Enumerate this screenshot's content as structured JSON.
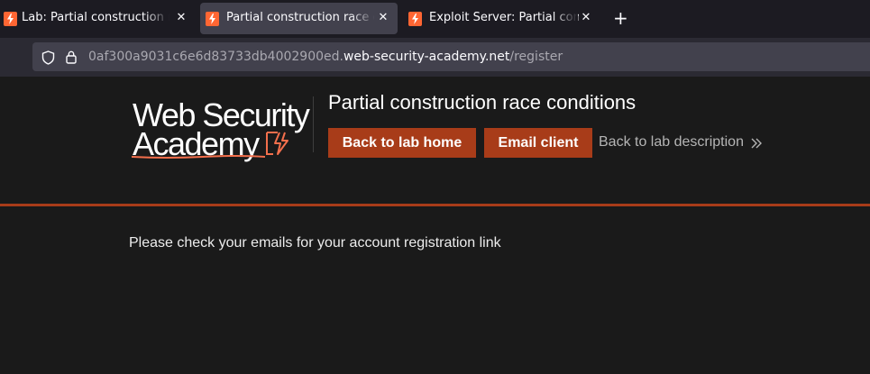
{
  "browser": {
    "tabs": [
      {
        "title": "Lab: Partial construction race conditions",
        "active": false,
        "icon": "bolt-icon"
      },
      {
        "title": "Partial construction race conditions",
        "active": true,
        "icon": "bolt-icon"
      },
      {
        "title": "Exploit Server: Partial construction race conditions",
        "active": false,
        "icon": "bolt-icon"
      }
    ],
    "close_glyph": "✕",
    "new_tab_glyph": "+",
    "url": {
      "prefix": "0af300a9031c6e6d83733db4002900ed.",
      "domain": "web-security-academy.net",
      "path": "/register"
    }
  },
  "header": {
    "logo_line1": "Web Security",
    "logo_line2": "Academy",
    "lab_title": "Partial construction race conditions",
    "back_to_lab_home": "Back to lab home",
    "email_client": "Email client",
    "back_to_lab_description": "Back to lab description"
  },
  "main": {
    "message": "Please check your emails for your account registration link"
  },
  "colors": {
    "accent": "#a83c19",
    "page_background": "#1a1a1a",
    "browser_chrome": "#2b2a33",
    "active_tab": "#42414d",
    "favicon": "#ff6633"
  }
}
